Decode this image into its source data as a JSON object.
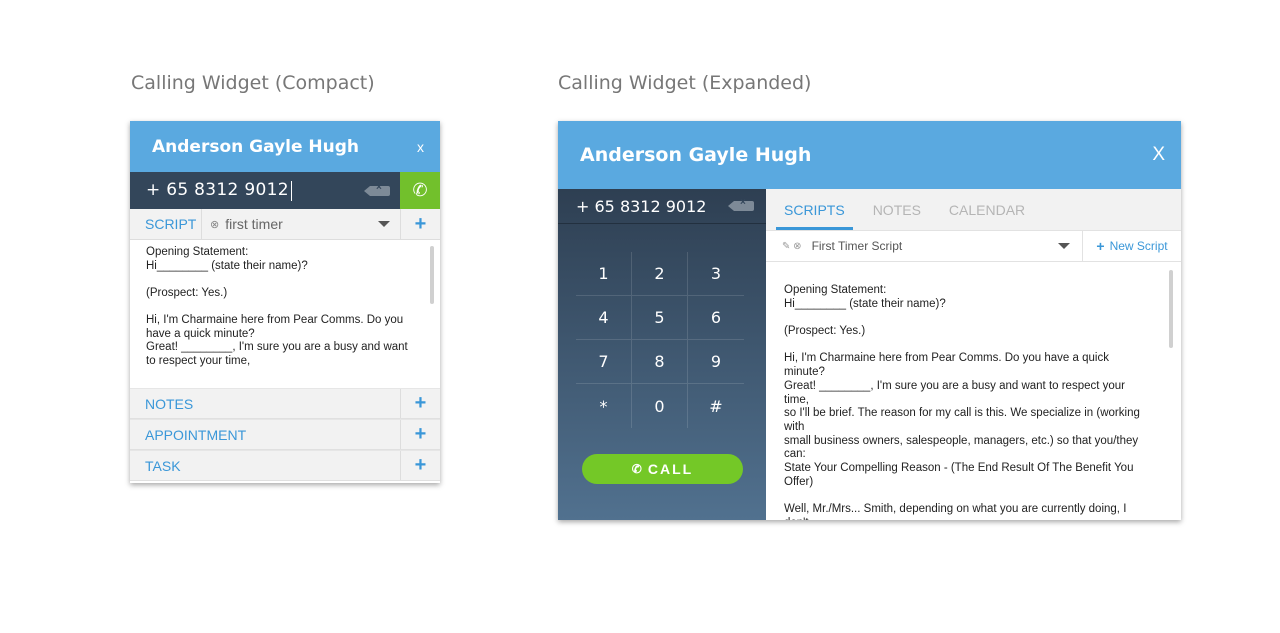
{
  "titles": {
    "compact": "Calling Widget (Compact)",
    "expanded": "Calling Widget (Expanded)"
  },
  "contact_name": "Anderson Gayle Hugh",
  "close_label": "X",
  "compact_close_label": "x",
  "phone_number": "+ 65 8312 9012",
  "compact": {
    "script_tab": "SCRIPT",
    "selected_script": "first timer",
    "script_lines": [
      "Opening Statement:\nHi________ (state their name)?",
      "(Prospect: Yes.)",
      "Hi, I'm Charmaine here from Pear Comms. Do you have a quick minute?\nGreat! ________, I'm sure you are a busy and want to respect your time,"
    ],
    "sections": [
      "NOTES",
      "APPOINTMENT",
      "TASK"
    ]
  },
  "expanded": {
    "tabs": [
      "SCRIPTS",
      "NOTES",
      "CALENDAR"
    ],
    "active_tab": "SCRIPTS",
    "selected_script": "First Timer Script",
    "new_script_label": "New Script",
    "keypad": [
      "1",
      "2",
      "3",
      "4",
      "5",
      "6",
      "7",
      "8",
      "9",
      "*",
      "0",
      "#"
    ],
    "call_label": "CALL",
    "script_paragraphs": [
      "Opening Statement:\nHi________ (state their name)?",
      "(Prospect: Yes.)",
      "Hi, I'm Charmaine here from Pear Comms. Do you have a quick minute?\nGreat! ________, I'm sure you are a busy and want to respect your time,\nso I'll be brief. The reason for my call is this. We specialize in (working with\nsmall business owners, salespeople, managers, etc.) so that you/they can:\nState Your Compelling Reason - (The End Result Of The Benefit You Offer)",
      "Well, Mr./Mrs... Smith, depending on what you are currently doing, I don't\nknow whether you have a need or an interest in our services. But with your\npermission, I was hoping to ask you a few questions and see if there is\nanything we are doing that you could benefit from. Would you be comfortable\nspending just a few minutes with me if I stick to my timetable?"
    ]
  },
  "colors": {
    "header": "#5aa9e0",
    "accent": "#3a97d8",
    "call_green": "#74c827",
    "dial_dark": "#33465a"
  }
}
